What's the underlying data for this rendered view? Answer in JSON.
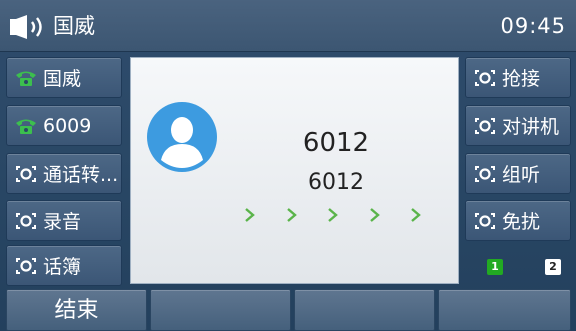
{
  "status_bar": {
    "line_name": "国威",
    "time": "09:45",
    "audio_icon": "speaker-icon"
  },
  "left_keys": [
    {
      "label": "国威",
      "icon": "phone-icon"
    },
    {
      "label": "6009",
      "icon": "phone-icon"
    },
    {
      "label": "通话转...",
      "icon": "function-key-icon"
    },
    {
      "label": "录音",
      "icon": "function-key-icon"
    },
    {
      "label": "话簿",
      "icon": "function-key-icon"
    }
  ],
  "right_keys": [
    {
      "label": "抢接",
      "icon": "function-key-icon"
    },
    {
      "label": "对讲机",
      "icon": "function-key-icon"
    },
    {
      "label": "组听",
      "icon": "function-key-icon"
    },
    {
      "label": "免扰",
      "icon": "function-key-icon"
    }
  ],
  "call": {
    "remote_name": "6012",
    "remote_number": "6012",
    "avatar_icon": "user-avatar-icon",
    "progress_icon": "chevron-right-icon"
  },
  "accounts": {
    "active": "1",
    "other": "2",
    "active_color": "#22aa22"
  },
  "softkeys": [
    "结束",
    "",
    "",
    ""
  ],
  "colors": {
    "phone_green": "#3cbf4e",
    "arrow_green": "#5ab44a",
    "avatar_blue": "#3d9be0"
  }
}
